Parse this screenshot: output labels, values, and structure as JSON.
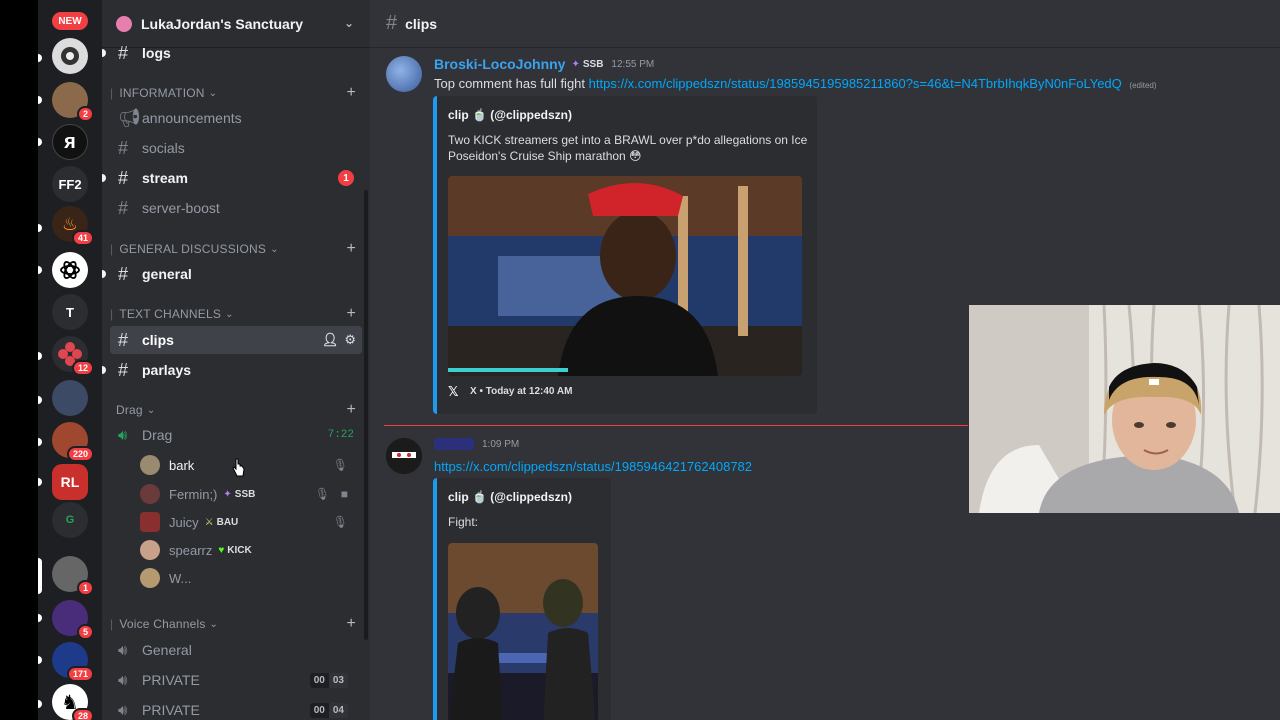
{
  "rail": {
    "new_badge": "NEW",
    "servers": [
      {
        "name": "server-1",
        "badge": ""
      },
      {
        "name": "server-2",
        "badge": "2"
      },
      {
        "name": "server-3",
        "badge": ""
      },
      {
        "name": "server-ff2",
        "label": "FF2",
        "badge": ""
      },
      {
        "name": "server-5",
        "badge": "41"
      },
      {
        "name": "server-openai",
        "badge": ""
      },
      {
        "name": "server-t",
        "label": "T",
        "badge": ""
      },
      {
        "name": "server-8",
        "badge": "12"
      },
      {
        "name": "server-9",
        "badge": ""
      },
      {
        "name": "server-10",
        "badge": "220"
      },
      {
        "name": "server-11",
        "badge": ""
      },
      {
        "name": "server-g",
        "label": "G",
        "badge": ""
      },
      {
        "name": "server-13",
        "badge": "1"
      },
      {
        "name": "server-14",
        "badge": "5"
      },
      {
        "name": "server-15",
        "badge": "171"
      },
      {
        "name": "server-16",
        "badge": "28"
      }
    ]
  },
  "sidebar": {
    "server_name": "LukaJordan's Sanctuary",
    "channels_top": [
      {
        "name": "logs",
        "unread": true
      }
    ],
    "categories": {
      "information": "INFORMATION",
      "general_discussions": "GENERAL DISCUSSIONS",
      "text_channels": "TEXT CHANNELS",
      "drag": "Drag",
      "voice_channels": "Voice Channels"
    },
    "information_channels": [
      {
        "name": "announcements",
        "unread": false
      },
      {
        "name": "socials",
        "unread": false
      },
      {
        "name": "stream",
        "unread": true,
        "mentions": "1"
      },
      {
        "name": "server-boost",
        "unread": false
      }
    ],
    "general_channels": [
      {
        "name": "general",
        "unread": true
      }
    ],
    "text_channels": [
      {
        "name": "clips",
        "active": true
      },
      {
        "name": "parlays",
        "unread": true
      }
    ],
    "drag_voice": {
      "name": "Drag",
      "timer": "7:22",
      "users": [
        {
          "name": "bark",
          "tag": "",
          "tag_icon": ""
        },
        {
          "name": "Fermin;)",
          "tag": "SSB",
          "tag_icon": "ssb-icon"
        },
        {
          "name": "Juicy",
          "tag": "BAU",
          "tag_icon": "sword-icon"
        },
        {
          "name": "spearrz",
          "tag": "KICK",
          "tag_icon": "heart-icon"
        },
        {
          "name": "W...",
          "tag": "",
          "tag_icon": ""
        }
      ]
    },
    "voice_channels": [
      {
        "name": "General",
        "count_a": "",
        "count_b": ""
      },
      {
        "name": "PRIVATE",
        "count_a": "00",
        "count_b": "03"
      },
      {
        "name": "PRIVATE",
        "count_a": "00",
        "count_b": "04"
      }
    ]
  },
  "chat": {
    "channel": "clips",
    "messages": [
      {
        "author": "Broski-LocoJohnny",
        "role_tag": "SSB",
        "time": "12:55 PM",
        "text": "Top comment has full fight",
        "link": "https://x.com/clippedszn/status/1985945195985211860?s=46&t=N4TbrbIhqkByN0nFoLYedQ",
        "edited": "(edited)",
        "embed": {
          "author": "clip 🍵 (@clippedszn)",
          "description": "Two KICK streamers get into a BRAWL over p*do allegations on Ice Poseidon's Cruise Ship marathon 😳",
          "footer": "X • Today at 12:40 AM"
        }
      },
      {
        "author": "",
        "time": "1:09 PM",
        "link": "https://x.com/clippedszn/status/1985946421762408782",
        "embed": {
          "author": "clip 🍵 (@clippedszn)",
          "description": "Fight:"
        }
      }
    ]
  },
  "colors": {
    "accent_link": "#00a8fc",
    "mention_red": "#f23f43",
    "voice_green": "#23a55a",
    "embed_border": "#1d9bf0"
  }
}
